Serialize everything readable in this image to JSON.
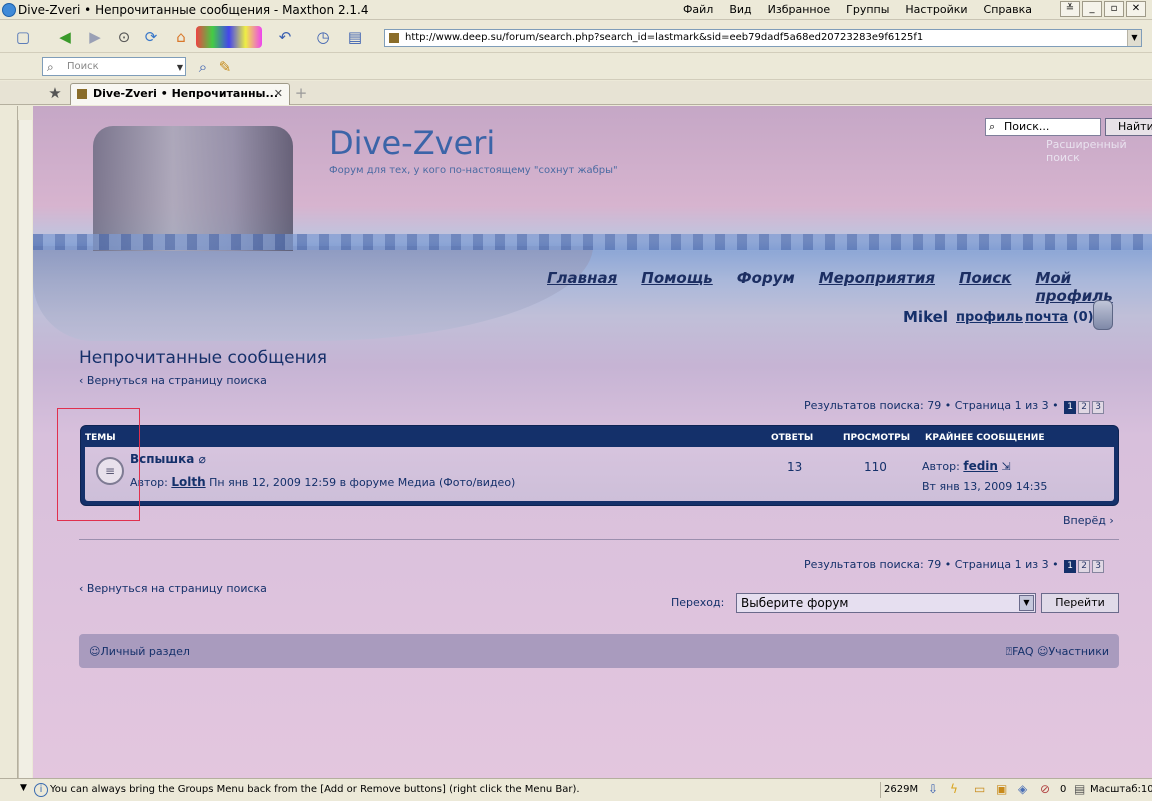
{
  "window": {
    "title": "Dive-Zveri • Непрочитанные сообщения - Maxthon 2.1.4",
    "menu": [
      "Файл",
      "Вид",
      "Избранное",
      "Группы",
      "Настройки",
      "Справка"
    ]
  },
  "browser": {
    "address": "http://www.deep.su/forum/search.php?search_id=lastmark&sid=eeb79dadf5a68ed20723283e9f6125f1",
    "search_placeholder": "Поиск",
    "tab_title": "Dive-Zveri • Непрочитанны...",
    "status_message": "You can always bring the Groups Menu back from the [Add or Remove buttons] (right click the Menu Bar).",
    "memory": "2629M",
    "counter": "0",
    "zoom_label": "Масштаб:10"
  },
  "site": {
    "name": "Dive-Zveri",
    "tagline": "Форум для тех, у кого по-настоящему \"сохнут жабры\"",
    "search_placeholder": "Поиск...",
    "search_button": "Найти",
    "advanced_search": "Расширенный поиск",
    "nav": [
      "Главная",
      "Помощь",
      "Форум",
      "Мероприятия",
      "Поиск",
      "Мой профиль"
    ],
    "user": "Mikel",
    "profile_link": "профиль",
    "mail_link": "почта",
    "mail_count": "(0)"
  },
  "main": {
    "heading": "Непрочитанные сообщения",
    "back_link": "Вернуться на страницу поиска",
    "results_text": "Результатов поиска: 79 • Страница 1 из 3 •",
    "pages": [
      "1",
      "2",
      "3"
    ],
    "columns": {
      "topics": "ТЕМЫ",
      "replies": "ОТВЕТЫ",
      "views": "ПРОСМОТРЫ",
      "last_post": "КРАЙНЕЕ СООБЩЕНИЕ"
    },
    "topic": {
      "title": "Вспышка",
      "author_prefix": "Автор:",
      "author": "Lolth",
      "meta": "Пн янв 12, 2009 12:59 в форуме Медиа (Фото/видео)",
      "replies": "13",
      "views": "110",
      "last_author_prefix": "Автор:",
      "last_author": "fedin",
      "last_date": "Вт янв 13, 2009 14:35"
    },
    "forward": "Вперёд",
    "jump_label": "Переход:",
    "jump_select": "Выберите форум",
    "jump_button": "Перейти",
    "footer_left": "Личный раздел",
    "footer_faq": "FAQ",
    "footer_members": "Участники"
  },
  "colors": {
    "accent": "#14306a",
    "logo": "#3b64a8"
  }
}
